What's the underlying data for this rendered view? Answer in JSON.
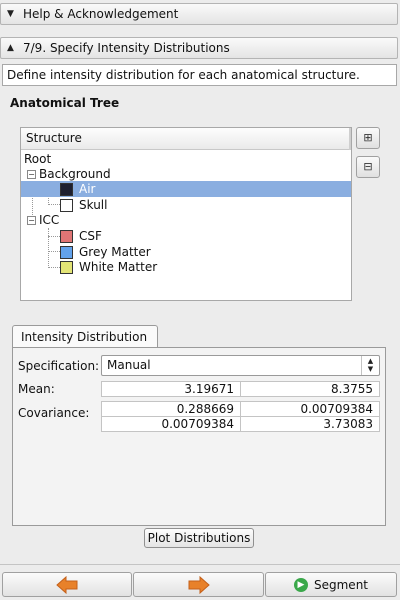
{
  "sections": {
    "help": {
      "title": "Help & Acknowledgement",
      "arrow_icon": "triangle-down"
    },
    "step": {
      "title": "7/9. Specify Intensity Distributions",
      "arrow_icon": "triangle-up"
    }
  },
  "description": "Define intensity distribution for each anatomical structure.",
  "tree": {
    "heading": "Anatomical Tree",
    "column_header": "Structure",
    "nodes": {
      "root": "Root",
      "background": "Background",
      "air": {
        "label": "Air",
        "color": "#1e2030"
      },
      "skull": {
        "label": "Skull",
        "color": "#ffffff"
      },
      "icc": "ICC",
      "csf": {
        "label": "CSF",
        "color": "#e07575"
      },
      "grey_matter": {
        "label": "Grey Matter",
        "color": "#62a2ec"
      },
      "white_matter": {
        "label": "White Matter",
        "color": "#e3e476"
      }
    },
    "selected": "air",
    "selection_color": "#8aaee0"
  },
  "tab": {
    "label": "Intensity Distribution",
    "specification_label": "Specification:",
    "specification_value": "Manual",
    "mean_label": "Mean:",
    "mean": [
      "3.19671",
      "8.3755"
    ],
    "covariance_label": "Covariance:",
    "covariance": [
      [
        "0.288669",
        "0.00709384"
      ],
      [
        "0.00709384",
        "3.73083"
      ]
    ]
  },
  "plot_button": "Plot Distributions",
  "navigation": {
    "back_icon": "arrow-left",
    "next_icon": "arrow-right",
    "segment_label": "Segment",
    "segment_icon": "go-circle",
    "arrow_color": "#e8812a"
  }
}
